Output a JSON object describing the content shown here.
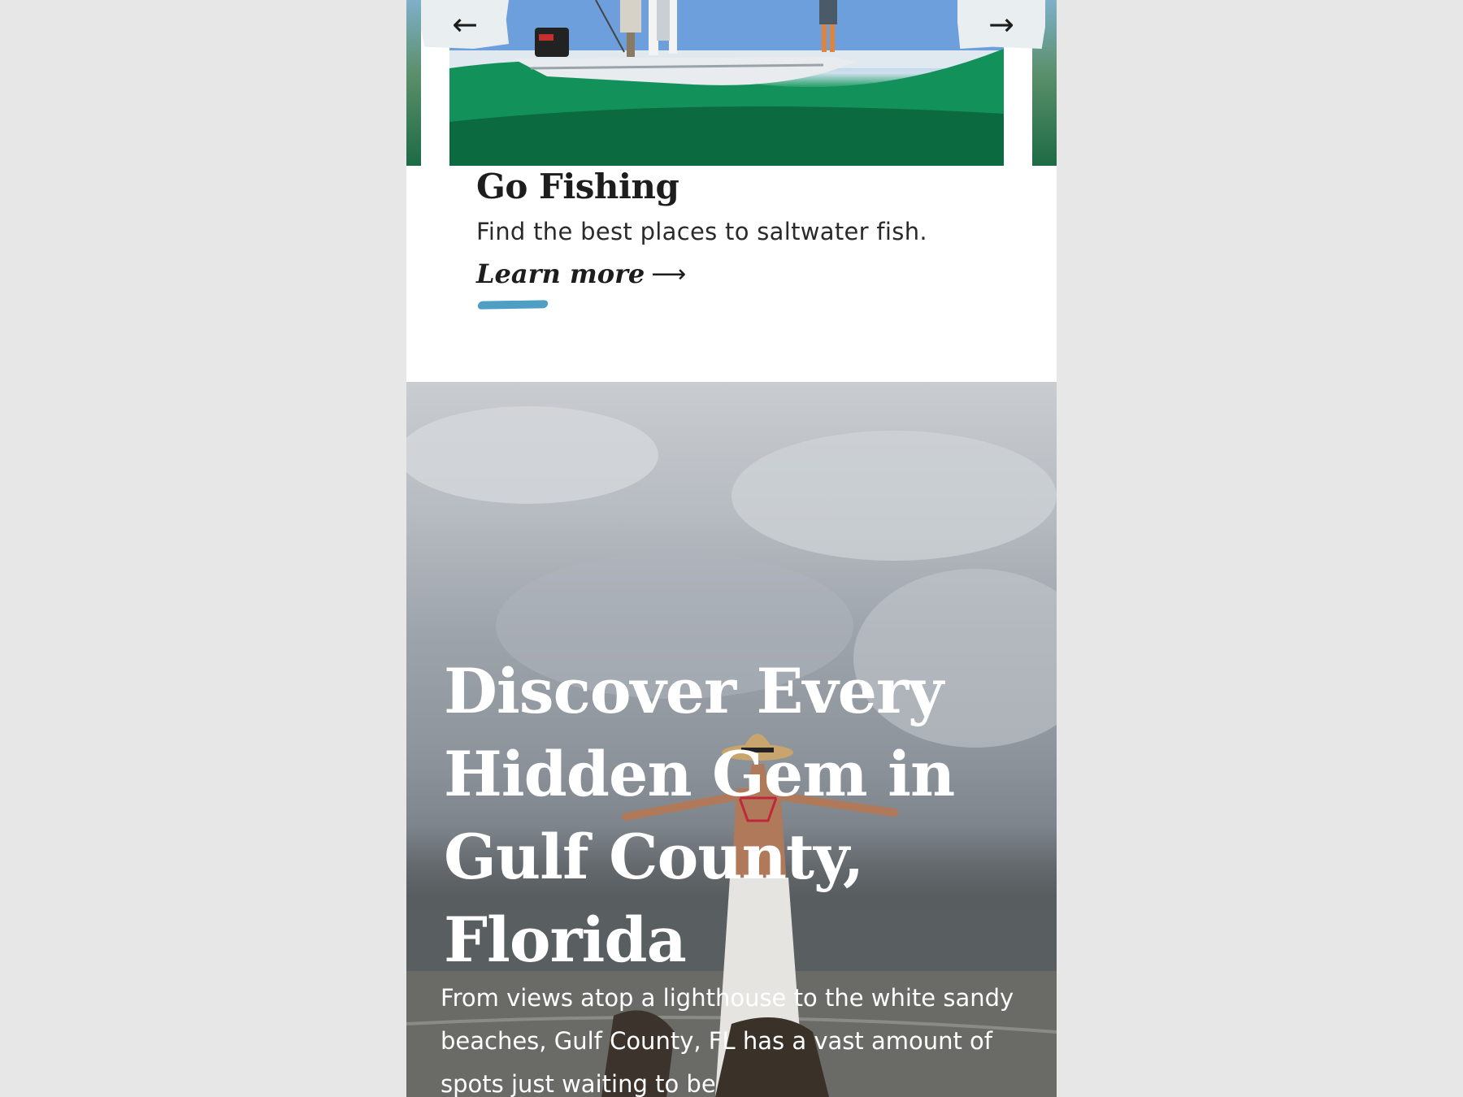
{
  "carousel": {
    "prev_icon": "arrow-left-icon",
    "next_icon": "arrow-right-icon",
    "prev_glyph": "←",
    "next_glyph": "→"
  },
  "card": {
    "title": "Go Fishing",
    "description": "Find the best places to saltwater fish.",
    "link_label": "Learn more",
    "link_arrow": "⟶"
  },
  "hero": {
    "title": "Discover Every Hidden Gem in Gulf County, Florida",
    "text": "From views atop a lighthouse to the white sandy beaches, Gulf County, FL has a vast amount of spots just waiting to be"
  },
  "colors": {
    "page_bg": "#e7e7e7",
    "accent_brush": "#4f9fc4",
    "text_dark": "#1d1d1d"
  }
}
